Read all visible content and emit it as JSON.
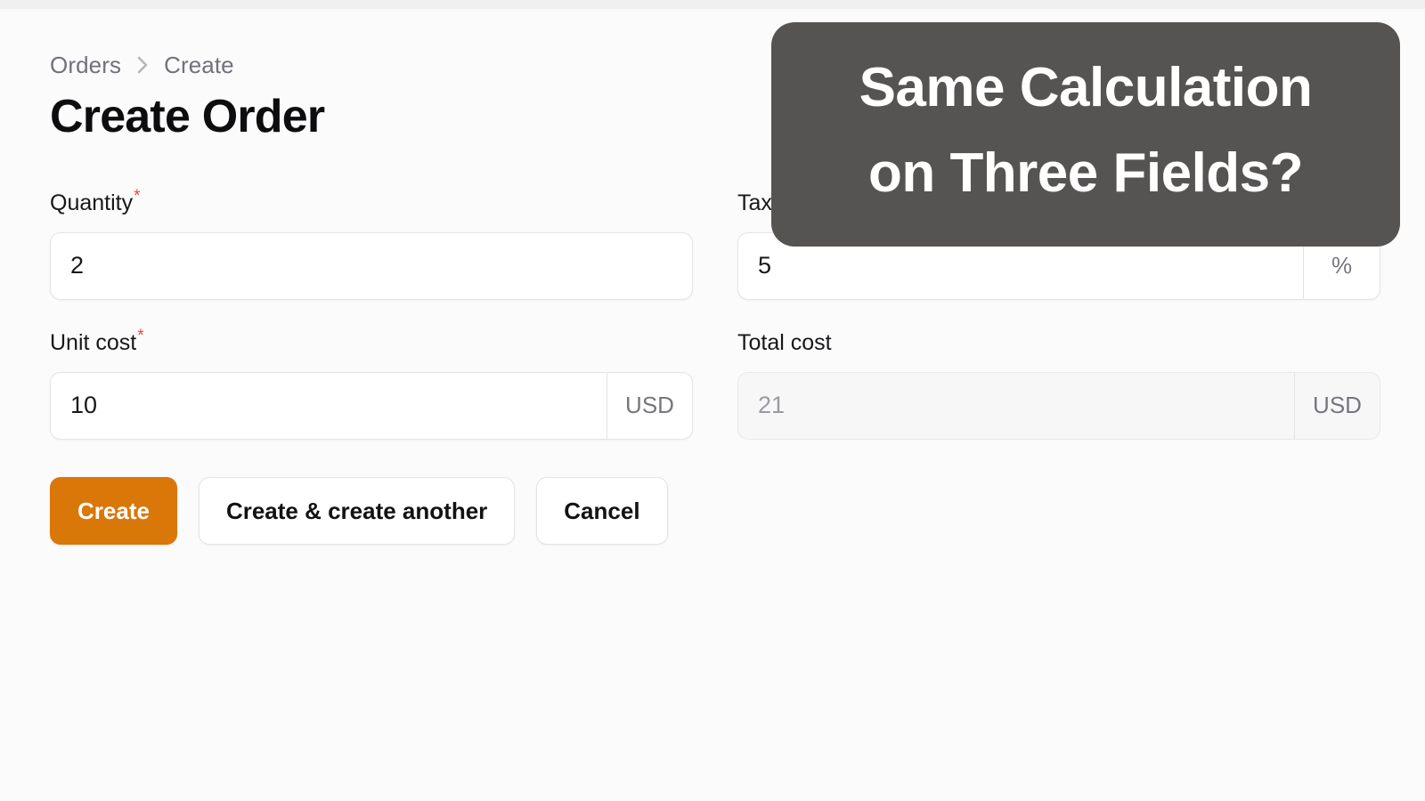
{
  "breadcrumb": {
    "items": [
      {
        "label": "Orders"
      },
      {
        "label": "Create"
      }
    ],
    "separator_icon": "chevron-right-icon"
  },
  "page": {
    "title": "Create Order"
  },
  "form": {
    "required_marker": "*",
    "fields": [
      {
        "name": "quantity",
        "label": "Quantity",
        "required": true,
        "value": "2",
        "placeholder": "",
        "suffix": "",
        "disabled": false
      },
      {
        "name": "tax",
        "label": "Tax",
        "required": true,
        "value": "5",
        "placeholder": "",
        "suffix": "%",
        "disabled": false
      },
      {
        "name": "unit_cost",
        "label": "Unit cost",
        "required": true,
        "value": "10",
        "placeholder": "",
        "suffix": "USD",
        "disabled": false
      },
      {
        "name": "total_cost",
        "label": "Total cost",
        "required": false,
        "value": "21",
        "placeholder": "",
        "suffix": "USD",
        "disabled": true
      }
    ]
  },
  "actions": {
    "create_label": "Create",
    "create_another_label": "Create & create another",
    "cancel_label": "Cancel"
  },
  "callout": {
    "line1": "Same Calculation",
    "line2": "on Three Fields?"
  },
  "colors": {
    "primary": "#d97708",
    "required_marker": "#ef4444",
    "callout_background": "#565453",
    "page_background": "#fbfbfb",
    "input_background": "#ffffff",
    "input_border": "#e4e4e7",
    "disabled_background": "#f7f7f8",
    "breadcrumb_text": "#71717a",
    "title_text": "#0d0d0f",
    "suffix_text": "#76767f"
  }
}
